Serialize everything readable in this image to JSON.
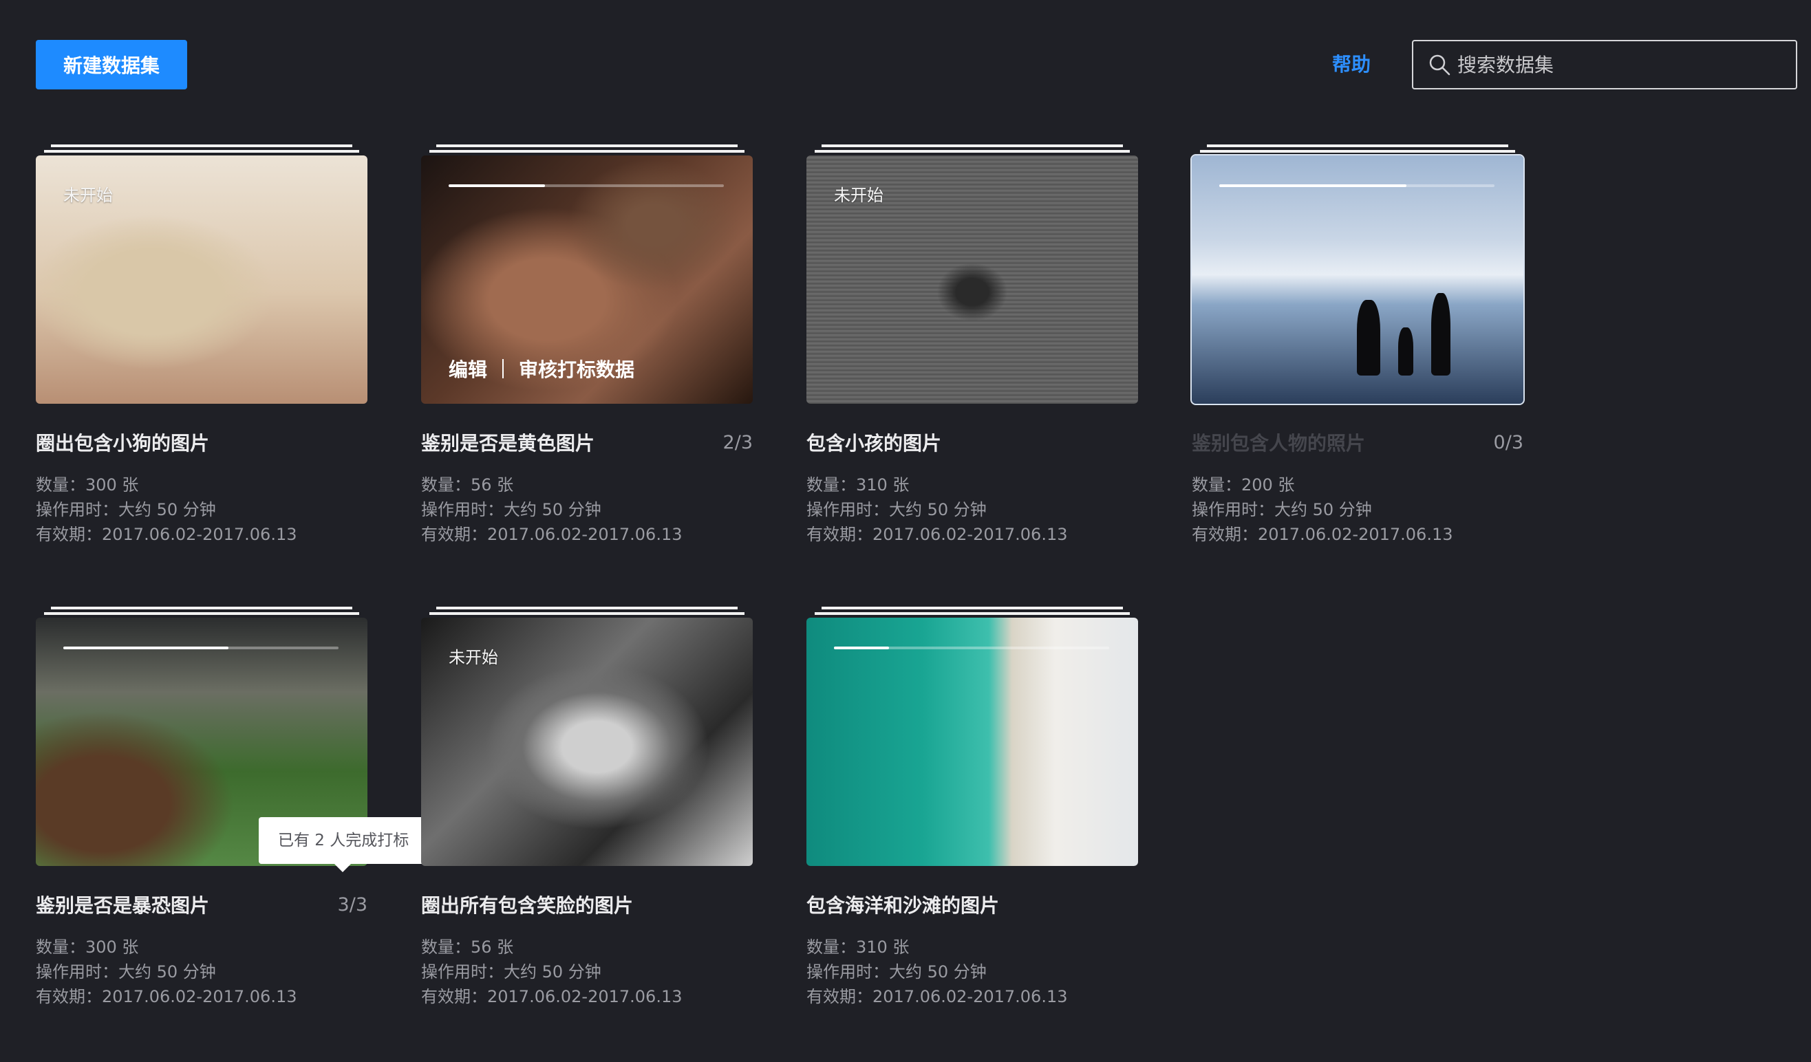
{
  "toolbar": {
    "new_dataset_label": "新建数据集",
    "help_label": "帮助",
    "search_placeholder": "搜索数据集",
    "search_icon": "search-icon"
  },
  "datasets": [
    {
      "title": "圈出包含小狗的图片",
      "status": "未开始",
      "count": "",
      "quantity": "数量：300 张",
      "duration": "操作用时：大约 50 分钟",
      "validity": "有效期：2017.06.02-2017.06.13",
      "progress": null
    },
    {
      "title": "鉴别是否是黄色图片",
      "status": "",
      "count": "2/3",
      "quantity": "数量：56 张",
      "duration": "操作用时：大约 50 分钟",
      "validity": "有效期：2017.06.02-2017.06.13",
      "progress": 0.35,
      "actions": {
        "edit": "编辑",
        "review": "审核打标数据"
      }
    },
    {
      "title": "包含小孩的图片",
      "status": "未开始",
      "count": "",
      "quantity": "数量：310 张",
      "duration": "操作用时：大约 50 分钟",
      "validity": "有效期：2017.06.02-2017.06.13",
      "progress": null
    },
    {
      "title": "鉴别包含人物的照片",
      "status": "",
      "count": "0/3",
      "quantity": "数量：200 张",
      "duration": "操作用时：大约 50 分钟",
      "validity": "有效期：2017.06.02-2017.06.13",
      "progress": 0.68
    },
    {
      "title": "鉴别是否是暴恐图片",
      "status": "",
      "count": "3/3",
      "quantity": "数量：300 张",
      "duration": "操作用时：大约 50 分钟",
      "validity": "有效期：2017.06.02-2017.06.13",
      "progress": 0.6,
      "tooltip": "已有 2 人完成打标"
    },
    {
      "title": "圈出所有包含笑脸的图片",
      "status": "未开始",
      "count": "",
      "quantity": "数量：56 张",
      "duration": "操作用时：大约 50 分钟",
      "validity": "有效期：2017.06.02-2017.06.13",
      "progress": null
    },
    {
      "title": "包含海洋和沙滩的图片",
      "status": "",
      "count": "",
      "quantity": "数量：310 张",
      "duration": "操作用时：大约 50 分钟",
      "validity": "有效期：2017.06.02-2017.06.13",
      "progress": 0.2
    }
  ]
}
